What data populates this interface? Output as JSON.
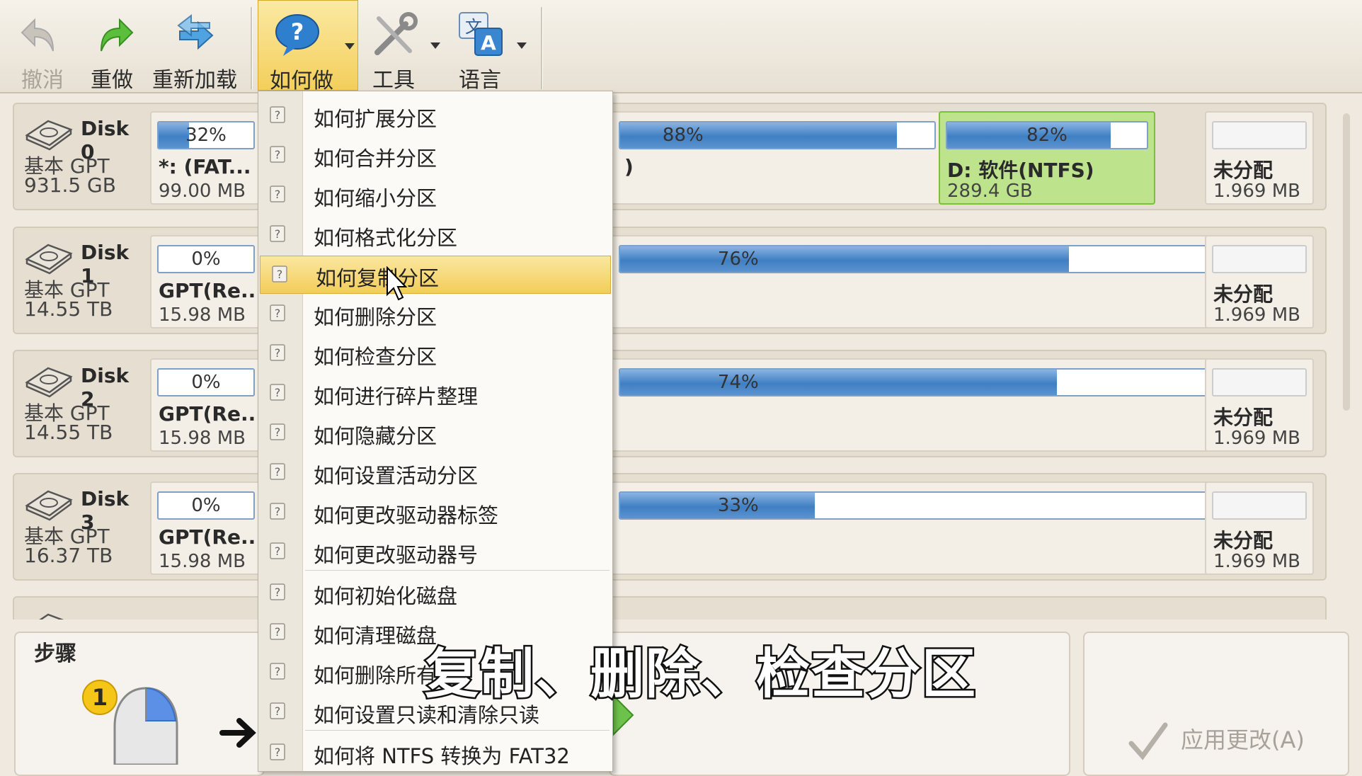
{
  "toolbar": {
    "undo": "撤消",
    "redo": "重做",
    "reload": "重新加载",
    "howto": "如何做",
    "tools": "工具",
    "language": "语言"
  },
  "icons": {
    "undo": "undo-arrow-icon",
    "redo": "redo-arrow-icon",
    "reload": "reload-icon",
    "howto": "question-bubble-icon",
    "tools": "wrench-screwdriver-icon",
    "language": "language-icon"
  },
  "colors": {
    "highlight": "#f3cd5a",
    "selected_partition": "#bde38c",
    "bar_fill": "#3f7fc3"
  },
  "disks": [
    {
      "name": "Disk 0",
      "type": "基本 GPT",
      "size": "931.5 GB",
      "first": {
        "pct": "32%",
        "fill": 0.32,
        "label": "*: (FAT...",
        "size": "99.00 MB"
      },
      "mid": {
        "pct": "88%",
        "fill": 0.88,
        "label_tail": ")"
      },
      "d": {
        "pct": "82%",
        "fill": 0.82,
        "label": "D: 软件(NTFS)",
        "size": "289.4 GB"
      },
      "unalloc": {
        "label": "未分配",
        "size": "1.969 MB"
      }
    },
    {
      "name": "Disk 1",
      "type": "基本 GPT",
      "size": "14.55 TB",
      "first": {
        "pct": "0%",
        "fill": 0.0,
        "label": "GPT(Re...",
        "size": "15.98 MB"
      },
      "mid": {
        "pct": "76%",
        "fill": 0.76
      },
      "unalloc": {
        "label": "未分配",
        "size": "1.969 MB"
      }
    },
    {
      "name": "Disk 2",
      "type": "基本 GPT",
      "size": "14.55 TB",
      "first": {
        "pct": "0%",
        "fill": 0.0,
        "label": "GPT(Re...",
        "size": "15.98 MB"
      },
      "mid": {
        "pct": "74%",
        "fill": 0.74
      },
      "unalloc": {
        "label": "未分配",
        "size": "1.969 MB"
      }
    },
    {
      "name": "Disk 3",
      "type": "基本 GPT",
      "size": "16.37 TB",
      "first": {
        "pct": "0%",
        "fill": 0.0,
        "label": "GPT(Re...",
        "size": "15.98 MB"
      },
      "mid": {
        "pct": "33%",
        "fill": 0.33
      },
      "unalloc": {
        "label": "未分配",
        "size": "1.969 MB"
      }
    }
  ],
  "menu": {
    "items": [
      "如何扩展分区",
      "如何合并分区",
      "如何缩小分区",
      "如何格式化分区",
      "如何复制分区",
      "如何删除分区",
      "如何检查分区",
      "如何进行碎片整理",
      "如何隐藏分区",
      "如何设置活动分区",
      "如何更改驱动器标签",
      "如何更改驱动器号",
      "如何初始化磁盘",
      "如何清理磁盘",
      "如何删除所有",
      "如何设置只读和清除只读",
      "如何将 NTFS 转换为 FAT32"
    ],
    "highlighted": 4
  },
  "steps": {
    "title": "步骤",
    "step_number": "1"
  },
  "apply_button": "应用更改(A)",
  "subtitle": "复制、删除、检查分区"
}
